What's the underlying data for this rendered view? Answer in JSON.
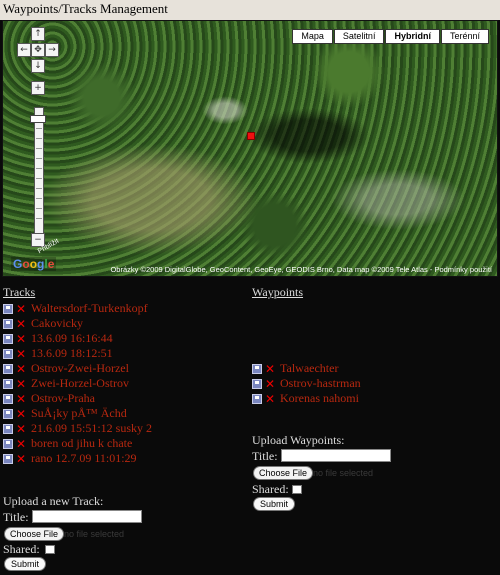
{
  "page_title": "Waypoints/Tracks Management",
  "map": {
    "types": [
      {
        "label": "Mapa",
        "active": false
      },
      {
        "label": "Satelitní",
        "active": false
      },
      {
        "label": "Hybridní",
        "active": true
      },
      {
        "label": "Terénní",
        "active": false
      }
    ],
    "copyright": "Obrázky ©2009 DigitalGlobe, GeoContent, GeoEye, GEODIS Brno, Data map ©2009 Tele Atlas - Podmínky použití",
    "logo": "Google",
    "scale_label": "Přiblížit"
  },
  "tracks": {
    "heading": "Tracks",
    "items": [
      "Waltersdorf-Turkenkopf",
      "Cakovicky",
      "13.6.09 16:16:44",
      "13.6.09 18:12:51",
      "Ostrov-Zwei-Horzel",
      "Zwei-Horzel-Ostrov",
      "Ostrov-Praha",
      "SuÅ¡ky pÅ™ Ächd",
      "21.6.09 15:51:12 susky 2",
      "boren od jihu k chate",
      "rano 12.7.09 11:01:29"
    ],
    "upload": {
      "heading": "Upload a new Track:",
      "title_label": "Title:",
      "file_button": "Choose File",
      "file_status": "no file selected",
      "shared_label": "Shared:",
      "submit": "Submit"
    }
  },
  "waypoints": {
    "heading": "Waypoints",
    "items": [
      "Talwaechter",
      "Ostrov-hastrman",
      "Korenas nahomi"
    ],
    "upload": {
      "heading": "Upload Waypoints:",
      "title_label": "Title:",
      "file_button": "Choose File",
      "file_status": "no file selected",
      "shared_label": "Shared:",
      "submit": "Submit"
    }
  }
}
